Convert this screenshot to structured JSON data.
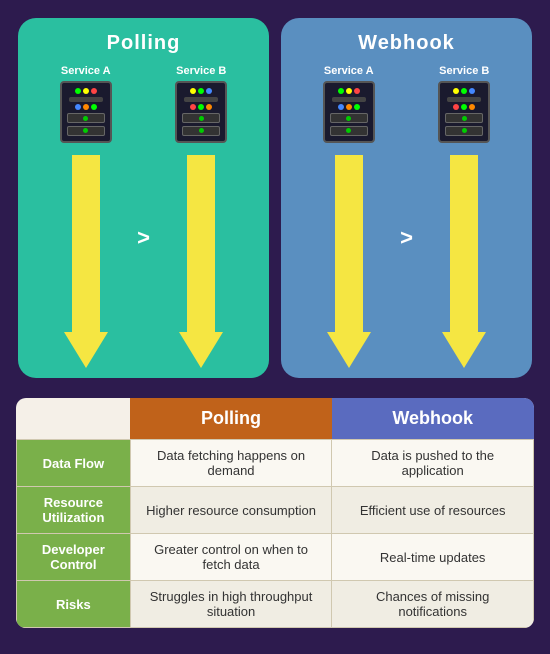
{
  "top": {
    "polling": {
      "title": "Polling",
      "serviceA": "Service A",
      "serviceB": "Service B"
    },
    "webhook": {
      "title": "Webhook",
      "serviceA": "Service A",
      "serviceB": "Service B"
    }
  },
  "table": {
    "headers": {
      "empty": "",
      "polling": "Polling",
      "webhook": "Webhook"
    },
    "rows": [
      {
        "label": "Data Flow",
        "polling": "Data fetching happens on demand",
        "webhook": "Data is pushed to the application"
      },
      {
        "label": "Resource Utilization",
        "polling": "Higher resource consumption",
        "webhook": "Efficient use of resources"
      },
      {
        "label": "Developer Control",
        "polling": "Greater control on when to fetch data",
        "webhook": "Real-time updates"
      },
      {
        "label": "Risks",
        "polling": "Struggles in high throughput situation",
        "webhook": "Chances of missing notifications"
      }
    ]
  }
}
